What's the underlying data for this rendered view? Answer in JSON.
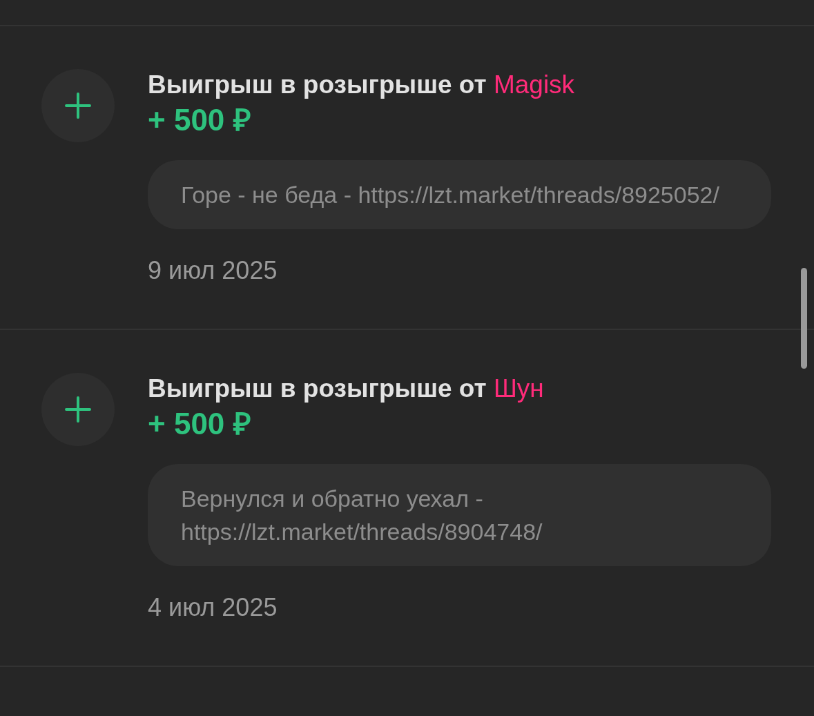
{
  "transactions": [
    {
      "title_prefix": "Выигрыш в розыгрыше от",
      "author": "Magisk",
      "amount": "+ 500 ₽",
      "message": "Горе - не беда - https://lzt.market/threads/8925052/",
      "date": "9 июл 2025"
    },
    {
      "title_prefix": "Выигрыш в розыгрыше от",
      "author": "Шун",
      "amount": "+ 500 ₽",
      "message": "Вернулся и обратно уехал - https://lzt.market/threads/8904748/",
      "date": "4 июл 2025"
    }
  ]
}
